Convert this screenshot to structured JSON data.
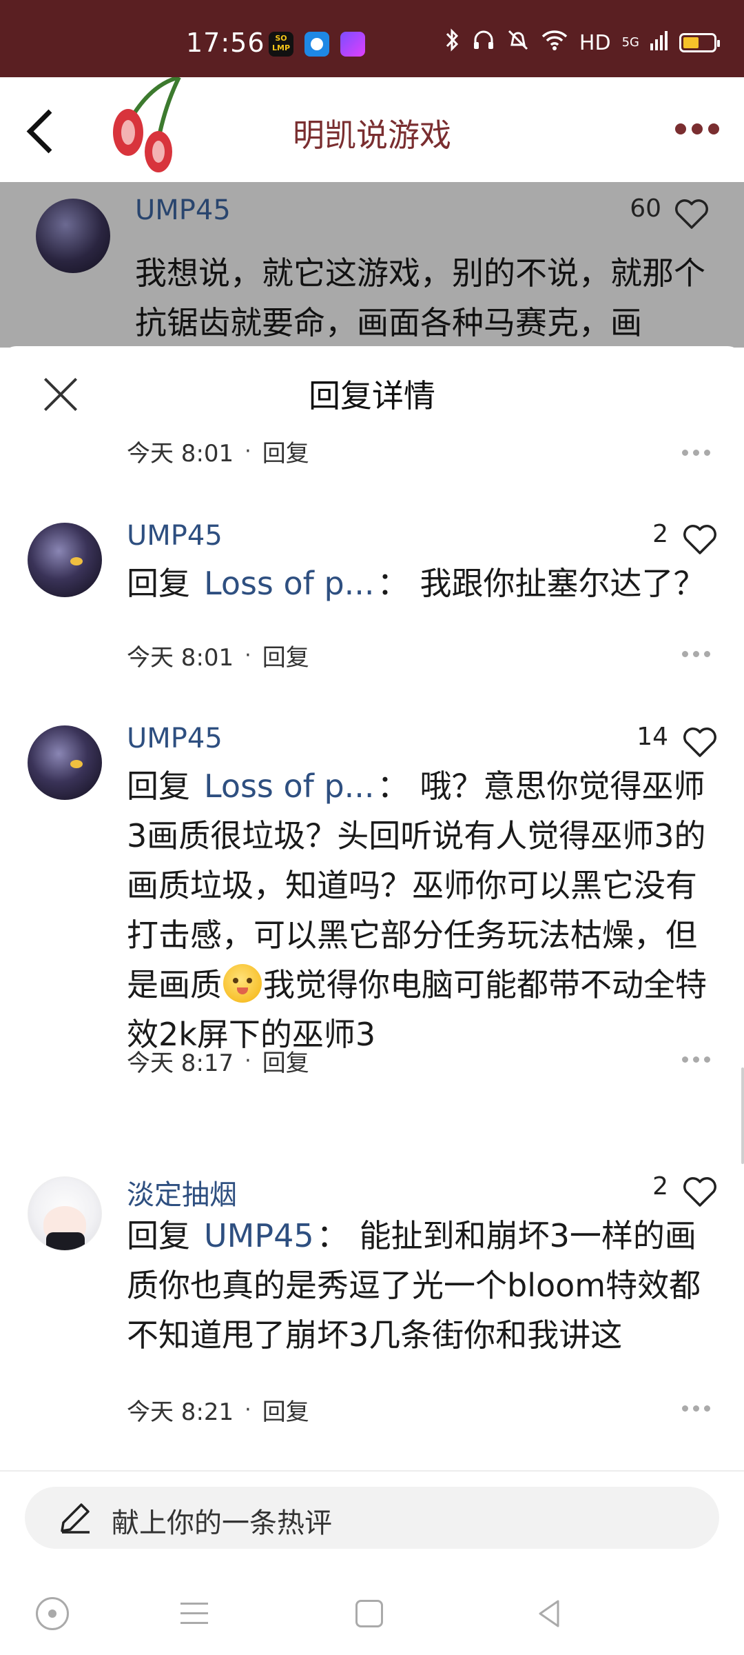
{
  "status_bar": {
    "time": "17:56",
    "app_icons": [
      "soap-app-icon",
      "browser-app-icon",
      "shortcut-app-icon"
    ],
    "soap_label": "SO\nLMP",
    "network": "HD",
    "signal": "5G"
  },
  "header": {
    "title": "明凯说游戏"
  },
  "background_comment": {
    "user": "UMP45",
    "likes": "60",
    "text": "我想说，就它这游戏，别的不说，就那个抗锯齿就要命，画面各种马赛克，画"
  },
  "sheet": {
    "title": "回复详情",
    "top_meta": {
      "time": "今天 8:01",
      "dot": "·",
      "reply": "回复"
    },
    "replies": [
      {
        "user": "UMP45",
        "likes": "2",
        "reply_word": "回复",
        "mention": "Loss of p...",
        "colon": "：",
        "text": "我跟你扯塞尔达了？",
        "time": "今天 8:01",
        "dot": "·",
        "reply": "回复"
      },
      {
        "user": "UMP45",
        "likes": "14",
        "reply_word": "回复",
        "mention": "Loss of p...",
        "colon": "：",
        "text_before_emoji": "哦？意思你觉得巫师3画质很垃圾？头回听说有人觉得巫师3的画质垃圾，知道吗？巫师你可以黑它没有打击感，可以黑它部分任务玩法枯燥，但是画质",
        "text_after_emoji": "我觉得你电脑可能都带不动全特效2k屏下的巫师3",
        "time": "今天 8:17",
        "dot": "·",
        "reply": "回复"
      },
      {
        "user": "淡定抽烟",
        "likes": "2",
        "reply_word": "回复",
        "mention": "UMP45",
        "colon": "：",
        "text": "能扯到和崩坏3一样的画质你也真的是秀逗了光一个bloom特效都不知道甩了崩坏3几条街你和我讲这",
        "time": "今天 8:21",
        "dot": "·",
        "reply": "回复"
      }
    ]
  },
  "compose": {
    "placeholder": "献上你的一条热评"
  },
  "colors": {
    "status_bar_bg": "#5a1f22",
    "title_color": "#7a2e30",
    "username_color": "#2e4f80"
  }
}
